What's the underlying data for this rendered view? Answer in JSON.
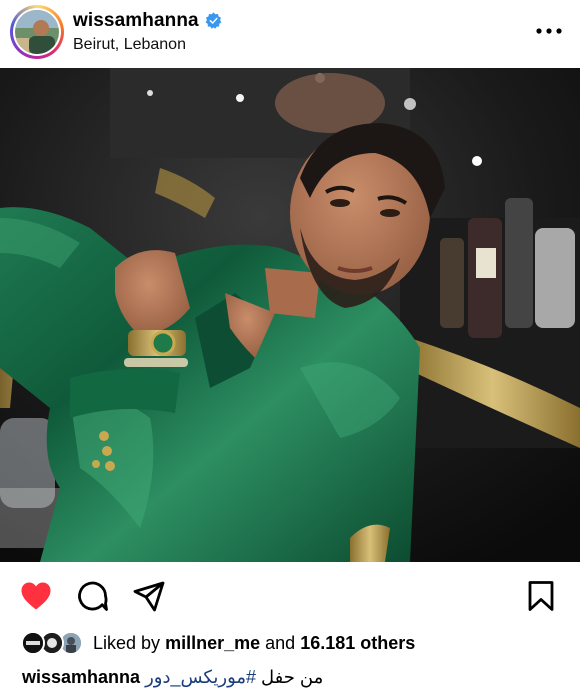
{
  "post": {
    "username": "wissamhanna",
    "location": "Beirut, Lebanon",
    "verified": true
  },
  "likes": {
    "prefix": "Liked by",
    "liker": "millner_me",
    "connector": "and",
    "others": "16.181 others"
  },
  "caption": {
    "username": "wissamhanna",
    "hashtag": "#موريكس_دور",
    "text": "من حفل"
  },
  "colors": {
    "like_red": "#ff3040",
    "verified_blue": "#3897f0",
    "hashtag_blue": "#1a3d7a"
  },
  "icons": {
    "verified": "verified-badge-icon",
    "more": "more-options-icon",
    "like": "heart-icon",
    "comment": "comment-icon",
    "share": "send-icon",
    "save": "bookmark-icon"
  }
}
